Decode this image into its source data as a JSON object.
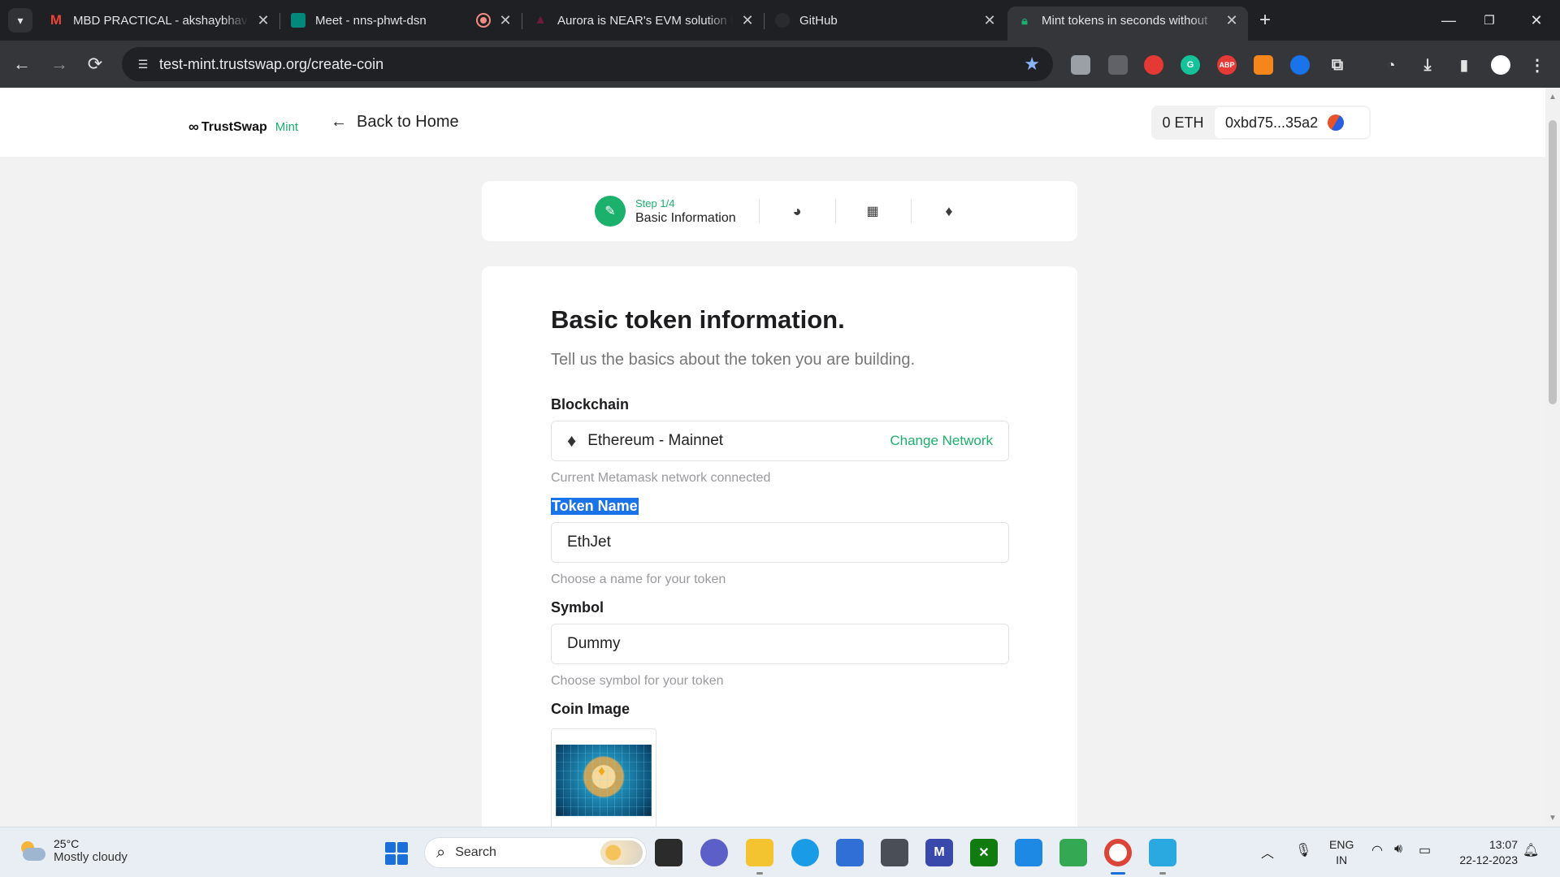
{
  "browser": {
    "tabs": [
      {
        "title": "MBD PRACTICAL - akshaybhavsar",
        "favicon": "gmail-icon",
        "active": false
      },
      {
        "title": "Meet - nns-phwt-dsn",
        "favicon": "meet-icon",
        "active": false
      },
      {
        "title": "Aurora is NEAR's EVM solution f",
        "favicon": "aurora-icon",
        "active": false
      },
      {
        "title": "GitHub",
        "favicon": "github-icon",
        "active": false
      },
      {
        "title": "Mint tokens in seconds without",
        "favicon": "lock-icon",
        "active": true
      }
    ],
    "url": "test-mint.trustswap.org/create-coin"
  },
  "header": {
    "logo_text": "TrustSwap",
    "logo_suffix": "Mint",
    "back_label": "Back to Home",
    "balance": "0 ETH",
    "address": "0xbd75...35a2"
  },
  "stepper": {
    "step_num": "Step 1/4",
    "step_title": "Basic Information"
  },
  "form": {
    "title": "Basic token information.",
    "subtitle": "Tell us the basics about the token you are building.",
    "blockchain_label": "Blockchain",
    "blockchain_value": "Ethereum - Mainnet",
    "change_network": "Change Network",
    "blockchain_hint": "Current Metamask network connected",
    "token_name_label": "Token Name",
    "token_name_value": "EthJet",
    "token_name_hint": "Choose a name for your token",
    "symbol_label": "Symbol",
    "symbol_value": "Dummy",
    "symbol_hint": "Choose symbol for your token",
    "coin_image_label": "Coin Image"
  },
  "taskbar": {
    "temperature": "25°C",
    "weather": "Mostly cloudy",
    "search_placeholder": "Search",
    "lang_1": "ENG",
    "lang_2": "IN",
    "time": "13:07",
    "date": "22-12-2023"
  },
  "colors": {
    "accent_green": "#1cb06d",
    "selection_blue": "#1a73e8",
    "chrome_dark": "#1f2024"
  }
}
